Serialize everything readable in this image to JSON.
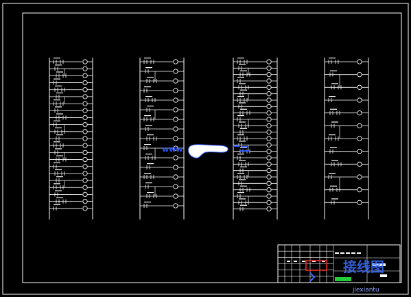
{
  "drawing": {
    "background": "#000000",
    "line_color": "#ffffff",
    "sheet_size": "A2"
  },
  "ladder_columns": [
    {
      "id": "col-1",
      "rungs": 22
    },
    {
      "id": "col-2",
      "rungs": 16
    },
    {
      "id": "col-3",
      "rungs": 24
    },
    {
      "id": "col-4",
      "rungs": 12
    }
  ],
  "watermark": {
    "text": "www",
    "color": "#2a55ff"
  },
  "corner_logo": {
    "brand_text": "接线图",
    "site_text": "jiexiantu",
    "color_red": "#ff2a2a",
    "color_blue": "#3a6dff",
    "color_green": "#2cff4a"
  }
}
